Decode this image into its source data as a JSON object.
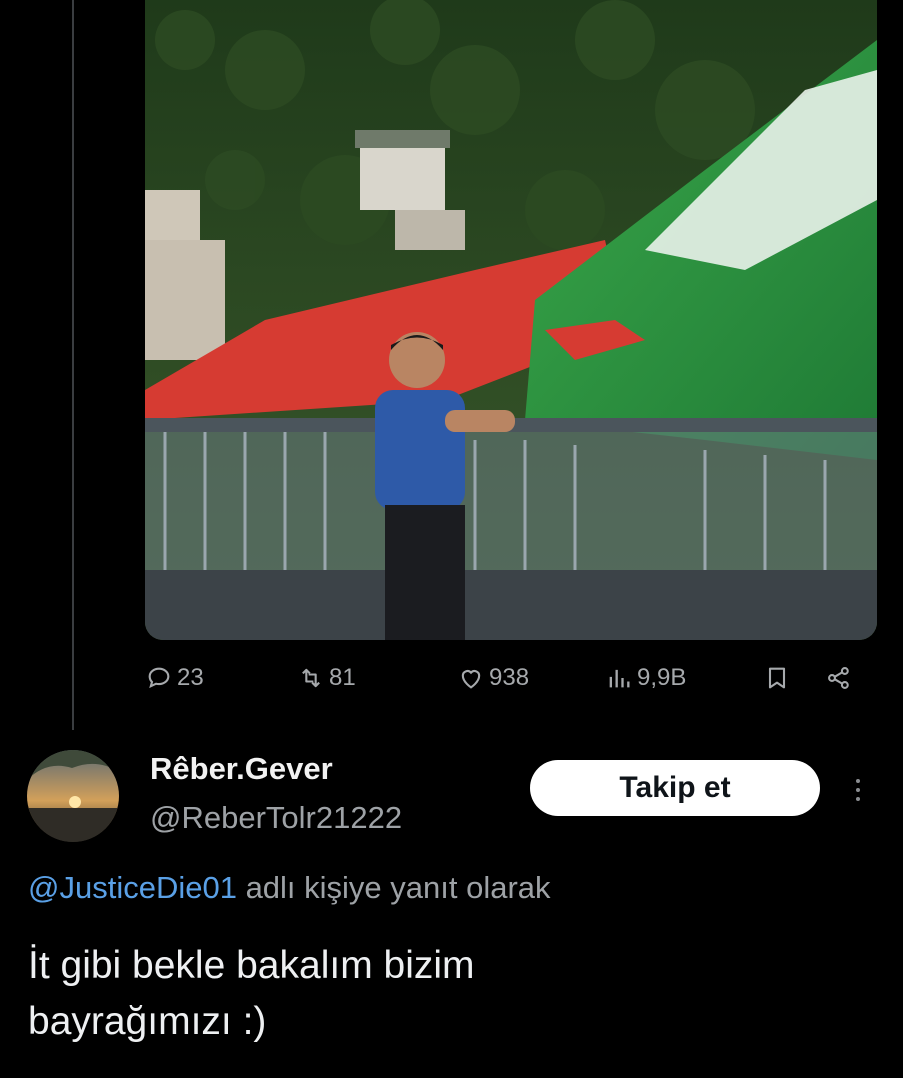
{
  "post": {
    "media_alt": "",
    "stats": {
      "replies": "23",
      "reposts": "81",
      "likes": "938",
      "views": "9,9B"
    },
    "icons": {
      "replies": "comment-icon",
      "reposts": "repost-icon",
      "likes": "heart-icon",
      "views": "views-chart-icon",
      "bookmark": "bookmark-icon",
      "share": "share-icon"
    }
  },
  "reply": {
    "display_name": "Rêber.Gever",
    "handle": "@ReberTolr21222",
    "follow_label": "Takip et",
    "replying_to_handle": "@JusticeDie01",
    "replying_to_suffix": " adlı kişiye yanıt olarak",
    "text_line1": "İt gibi bekle bakalım bizim",
    "text_line2": "bayrağımızı :)"
  },
  "colors": {
    "background": "#000000",
    "link": "#5aa0e6",
    "muted": "#9ea2a6",
    "button_bg": "#ffffff"
  }
}
